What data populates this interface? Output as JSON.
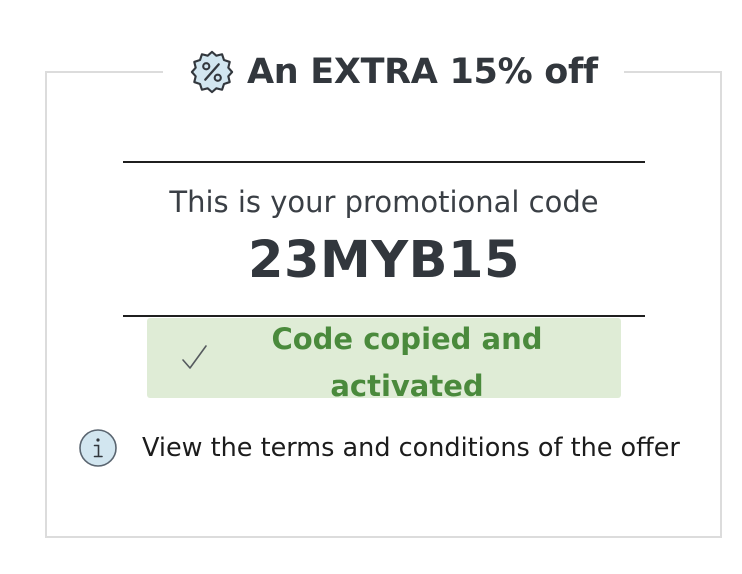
{
  "offer": {
    "title": "An EXTRA 15% off",
    "badge_icon": "percent-badge-icon"
  },
  "code": {
    "intro": "This is your promotional code",
    "value": "23MYB15"
  },
  "status": {
    "icon": "checkmark-icon",
    "text": "Code copied and activated",
    "background": "#dfecd6",
    "color": "#4a8a3c"
  },
  "terms": {
    "icon": "info-icon",
    "link_text": "View the terms and conditions of the offer"
  }
}
